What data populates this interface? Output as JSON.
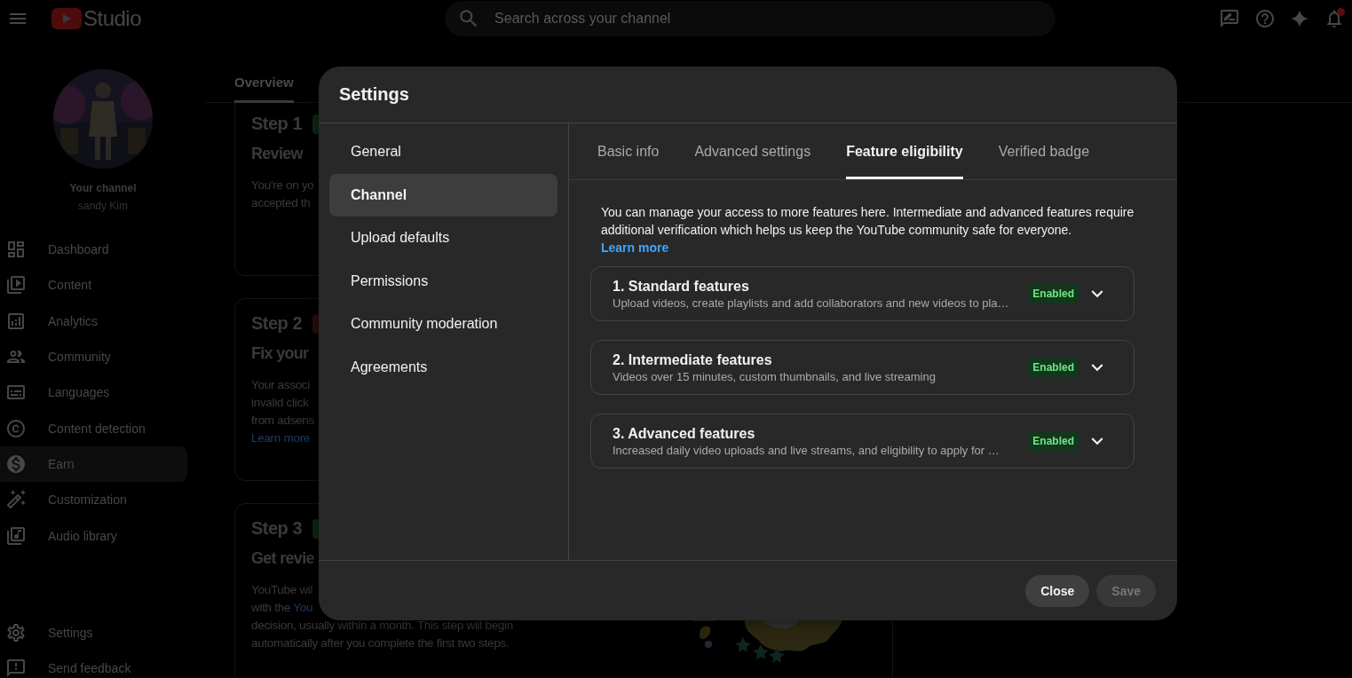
{
  "header": {
    "brand": "Studio",
    "search": {
      "placeholder": "Search across your channel"
    },
    "notifications": {
      "unread": true
    }
  },
  "sidebar": {
    "channel_label": "Your channel",
    "channel_name": "sandy Kim",
    "items": [
      {
        "label": "Dashboard",
        "selected": false
      },
      {
        "label": "Content",
        "selected": false
      },
      {
        "label": "Analytics",
        "selected": false
      },
      {
        "label": "Community",
        "selected": false
      },
      {
        "label": "Languages",
        "selected": false
      },
      {
        "label": "Content detection",
        "selected": false
      },
      {
        "label": "Earn",
        "selected": true
      },
      {
        "label": "Customization",
        "selected": false
      },
      {
        "label": "Audio library",
        "selected": false
      }
    ],
    "footer_items": [
      {
        "label": "Settings"
      },
      {
        "label": "Send feedback"
      }
    ]
  },
  "page": {
    "tabs": [
      {
        "label": "Overview",
        "selected": true
      }
    ],
    "steps": [
      {
        "step": "Step 1",
        "color": "#0f2a14",
        "title": "Review",
        "lines": [
          {
            "text": "You're on yo"
          },
          {
            "text": "accepted th"
          }
        ]
      },
      {
        "step": "Step 2",
        "color": "#2e0d0d",
        "title": "Fix your",
        "lines": [
          {
            "text": "Your associ"
          },
          {
            "text": "invalid click"
          },
          {
            "text": "from adsens"
          },
          {
            "link": "Learn more"
          }
        ]
      },
      {
        "step": "Step 3",
        "color": "#0f2a14",
        "title": "Get revie",
        "lines": [
          {
            "text": "YouTube wil"
          },
          {
            "text": "with the ",
            "link": "You"
          },
          {
            "text": "decision, usually within a month. This step will begin"
          },
          {
            "text": "automatically after you complete the first two steps."
          }
        ],
        "illustration": true
      }
    ]
  },
  "dialog": {
    "title": "Settings",
    "nav": [
      {
        "label": "General",
        "selected": false
      },
      {
        "label": "Channel",
        "selected": true
      },
      {
        "label": "Upload defaults",
        "selected": false
      },
      {
        "label": "Permissions",
        "selected": false
      },
      {
        "label": "Community moderation",
        "selected": false
      },
      {
        "label": "Agreements",
        "selected": false
      }
    ],
    "tabs": [
      {
        "label": "Basic info",
        "selected": false
      },
      {
        "label": "Advanced settings",
        "selected": false
      },
      {
        "label": "Feature eligibility",
        "selected": true
      },
      {
        "label": "Verified badge",
        "selected": false
      }
    ],
    "intro": "You can manage your access to more features here. Intermediate and advanced features require additional verification which helps us keep the YouTube community safe for everyone.",
    "learn_more": "Learn more",
    "features": [
      {
        "title": "1. Standard features",
        "description": "Upload videos, create playlists and add collaborators and new videos to pla…",
        "status": "Enabled",
        "expanded": false
      },
      {
        "title": "2. Intermediate features",
        "description": "Videos over 15 minutes, custom thumbnails, and live streaming",
        "status": "Enabled",
        "expanded": false
      },
      {
        "title": "3. Advanced features",
        "description": "Increased daily video uploads and live streams, and eligibility to apply for …",
        "status": "Enabled",
        "expanded": false
      }
    ],
    "buttons": [
      {
        "label": "Close",
        "disabled": false
      },
      {
        "label": "Save",
        "disabled": true
      }
    ]
  }
}
